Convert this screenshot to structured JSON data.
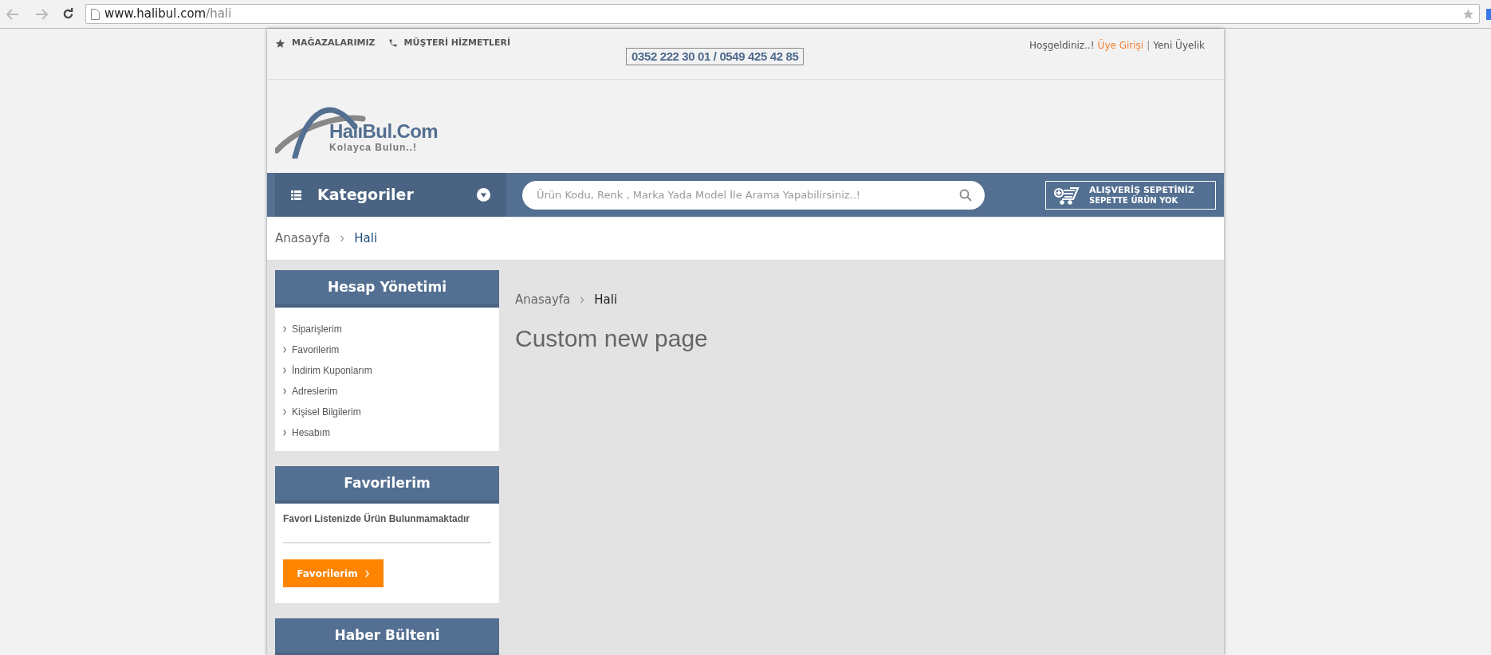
{
  "browser": {
    "url_host": "www.halibul.com",
    "url_path": "/hali"
  },
  "topbar": {
    "links": [
      {
        "label": "MAĞAZALARIMIZ",
        "kind": "star"
      },
      {
        "label": "MÜŞTERİ HİZMETLERİ",
        "kind": "phone"
      }
    ],
    "phone": "0352 222 30 01 / 0549 425 42 85",
    "welcome": "Hoşgeldiniz..!",
    "login": "Üye Girişi",
    "separator": "|",
    "register": "Yeni Üyelik"
  },
  "logo": {
    "name": "HalıBul.Com",
    "tagline": "Kolayca Bulun..!"
  },
  "navbar": {
    "categories": "Kategoriler",
    "search_placeholder": "Ürün Kodu, Renk , Marka Yada Model İle Arama Yapabilirsiniz..!",
    "cart_title": "ALIŞVERİŞ SEPETİNİZ",
    "cart_subtitle": "SEPETTE ÜRÜN YOK"
  },
  "breadcrumb": [
    "Anasayfa",
    "Hali"
  ],
  "sidebar": [
    {
      "kind": "menu",
      "title": "Hesap Yönetimi",
      "items": [
        "Siparişlerim",
        "Favorilerim",
        "İndirim Kuponlarım",
        "Adreslerim",
        "Kişisel Bilgilerim",
        "Hesabım"
      ]
    },
    {
      "kind": "favorites",
      "title": "Favorilerim",
      "message": "Favori Listenizde Ürün Bulunmamaktadır",
      "button": "Favorilerim"
    },
    {
      "kind": "newsletter",
      "title": "Haber Bülteni"
    }
  ],
  "content": {
    "breadcrumb": [
      "Anasayfa",
      "Hali"
    ],
    "title": "Custom new page"
  }
}
